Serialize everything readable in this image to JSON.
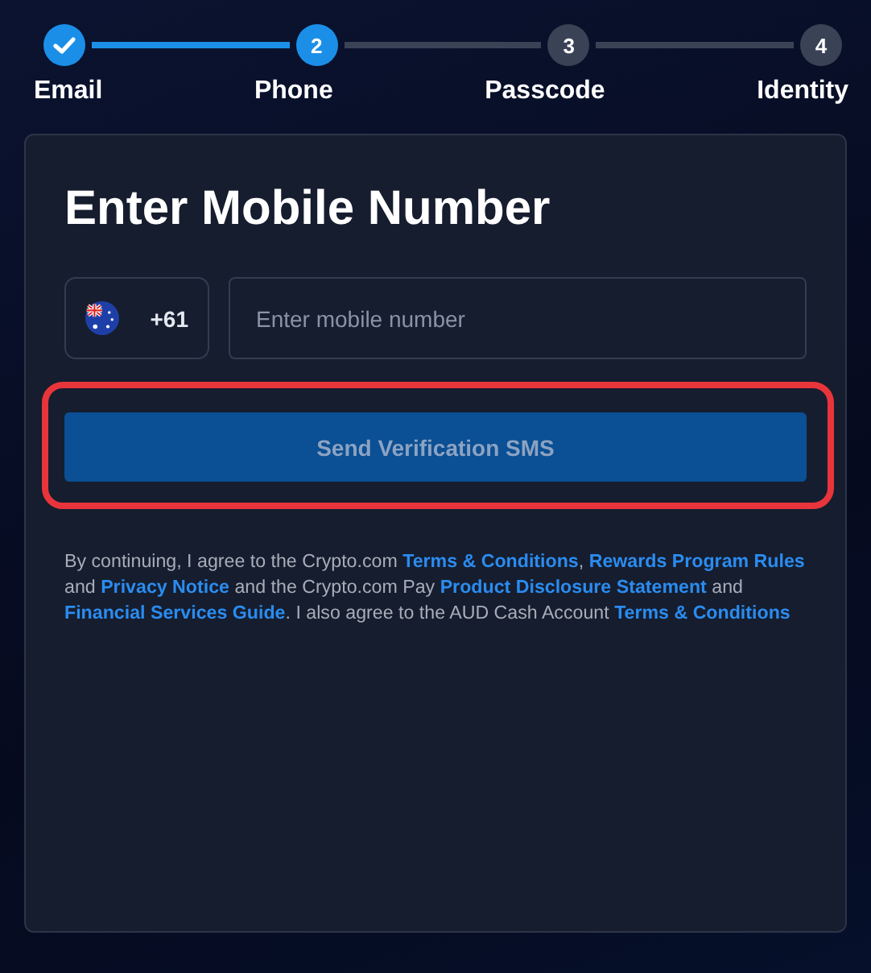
{
  "steps": [
    {
      "label": "Email",
      "completed": true,
      "selected": false
    },
    {
      "label": "Phone",
      "completed": false,
      "selected": true,
      "number": "2"
    },
    {
      "label": "Passcode",
      "completed": false,
      "selected": false,
      "number": "3"
    },
    {
      "label": "Identity",
      "completed": false,
      "selected": false,
      "number": "4"
    }
  ],
  "card": {
    "title": "Enter Mobile Number",
    "country": {
      "code": "+61"
    },
    "phone": {
      "placeholder": "Enter mobile number"
    },
    "button": {
      "label": "Send Verification SMS",
      "disabled": true,
      "highlighted": true
    },
    "legal": [
      {
        "text": "By continuing, I agree to the Crypto.com ",
        "kind": "text"
      },
      {
        "text": "Terms & Conditions",
        "kind": "link"
      },
      {
        "text": ", ",
        "kind": "text"
      },
      {
        "text": "Rewards Program Rules",
        "kind": "link"
      },
      {
        "text": " and ",
        "kind": "text"
      },
      {
        "text": "Privacy Notice",
        "kind": "link"
      },
      {
        "text": " and the Crypto.com Pay ",
        "kind": "text"
      },
      {
        "text": "Product Disclosure Statement",
        "kind": "link"
      },
      {
        "text": " and ",
        "kind": "text"
      },
      {
        "text": "Financial Services Guide",
        "kind": "link"
      },
      {
        "text": ". I also agree to the AUD Cash Account ",
        "kind": "text"
      },
      {
        "text": "Terms & Conditions",
        "kind": "link"
      }
    ]
  }
}
